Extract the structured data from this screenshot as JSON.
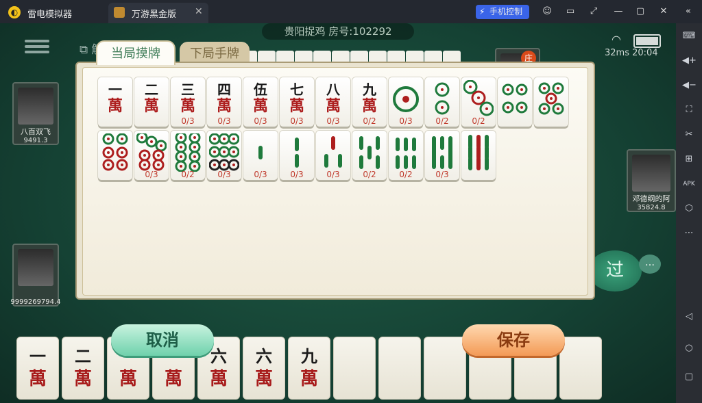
{
  "titlebar": {
    "app_name": "雷电模拟器",
    "tab_label": "万游黑金版",
    "control_label": "手机控制"
  },
  "game": {
    "room_info": "贵阳捉鸡  房号:102292",
    "dissolve_label": "解散",
    "ping": "32ms",
    "clock": "20:04",
    "pass_label": "过",
    "dealer_label": "庄",
    "players": [
      {
        "name": "八百双飞",
        "score": "9491.3"
      },
      {
        "name": "",
        "score": "9999269794.4"
      },
      {
        "name": "邓德纲的阿",
        "score": "35824.8"
      }
    ]
  },
  "panel": {
    "tab_current": "当局摸牌",
    "tab_next": "下局手牌",
    "tiles": [
      {
        "suit": "wan",
        "face": "一",
        "count": ""
      },
      {
        "suit": "wan",
        "face": "二",
        "count": ""
      },
      {
        "suit": "wan",
        "face": "三",
        "count": "0/3"
      },
      {
        "suit": "wan",
        "face": "四",
        "count": "0/3"
      },
      {
        "suit": "wan",
        "face": "伍",
        "count": "0/3"
      },
      {
        "suit": "wan",
        "face": "七",
        "count": "0/3"
      },
      {
        "suit": "wan",
        "face": "八",
        "count": "0/3"
      },
      {
        "suit": "wan",
        "face": "九",
        "count": "0/2"
      },
      {
        "suit": "tong",
        "n": 1,
        "count": "0/3"
      },
      {
        "suit": "tong",
        "n": 2,
        "count": "0/2"
      },
      {
        "suit": "tong",
        "n": 3,
        "count": "0/2"
      },
      {
        "suit": "tong",
        "n": 4,
        "count": ""
      },
      {
        "suit": "tong",
        "n": 5,
        "count": ""
      },
      {
        "suit": "tong",
        "n": 6,
        "count": ""
      },
      {
        "suit": "tong",
        "n": 7,
        "count": "0/3"
      },
      {
        "suit": "tong",
        "n": 8,
        "count": "0/2"
      },
      {
        "suit": "tong",
        "n": 9,
        "count": "0/3"
      },
      {
        "suit": "tiao",
        "n": 1,
        "count": "0/3"
      },
      {
        "suit": "tiao",
        "n": 2,
        "count": "0/3"
      },
      {
        "suit": "tiao",
        "n": 3,
        "count": "0/3"
      },
      {
        "suit": "tiao",
        "n": 5,
        "count": "0/2"
      },
      {
        "suit": "tiao",
        "n": 6,
        "count": "0/2"
      },
      {
        "suit": "tiao",
        "n": 8,
        "count": "0/3"
      },
      {
        "suit": "tiao",
        "n": 9,
        "count": ""
      }
    ]
  },
  "hand": [
    "一",
    "二",
    "",
    "",
    "六",
    "六",
    "九"
  ],
  "buttons": {
    "cancel": "取消",
    "save": "保存"
  },
  "colors": {
    "felt": "#1f5b45",
    "wan_red": "#ad1e1e",
    "tong_green": "#1f7a3c",
    "cancel": "#6fd1ac",
    "save": "#f39a56"
  }
}
